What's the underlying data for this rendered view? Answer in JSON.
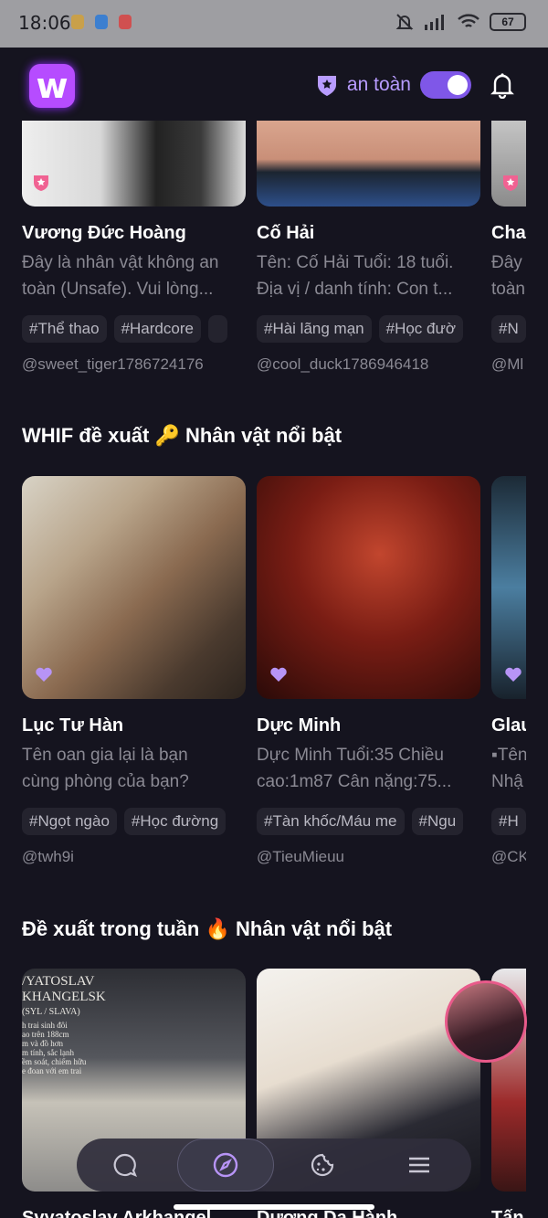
{
  "status_bar": {
    "time": "18:06",
    "battery": "67"
  },
  "header": {
    "logo_letter": "w",
    "safe_label": "an toàn"
  },
  "row1": [
    {
      "name": "Vương Đức Hoàng",
      "desc": [
        "Đây là nhân vật không an",
        "toàn (Unsafe). Vui lòng..."
      ],
      "tags": [
        "#Thể thao",
        "#Hardcore"
      ],
      "author": "@sweet_tiger1786724176"
    },
    {
      "name": "Cố Hải",
      "desc": [
        "Tên: Cố Hải Tuổi: 18 tuổi.",
        "Địa vị / danh tính: Con t..."
      ],
      "tags": [
        "#Hài lãng mạn",
        "#Học đườ"
      ],
      "author": "@cool_duck1786946418"
    },
    {
      "name": "Cha",
      "desc": [
        "Đây",
        "toàn"
      ],
      "tags": [
        "#N"
      ],
      "author": "@Ml"
    }
  ],
  "section2": {
    "title": "WHIF đề xuất 🔑 Nhân vật nổi bật"
  },
  "row2": [
    {
      "name": "Lục Tư Hàn",
      "desc": [
        "Tên oan gia lại là bạn",
        "cùng phòng của bạn?"
      ],
      "tags": [
        "#Ngọt ngào",
        "#Học đường"
      ],
      "author": "@twh9i"
    },
    {
      "name": "Dực Minh",
      "desc": [
        "Dực Minh Tuổi:35 Chiều",
        "cao:1m87 Cân nặng:75..."
      ],
      "tags": [
        "#Tàn khốc/Máu me",
        "#Ngu"
      ],
      "author": "@TieuMieuu"
    },
    {
      "name": "Glau",
      "desc": [
        "▪Tên",
        "Nhậ"
      ],
      "tags": [
        "#H"
      ],
      "author": "@CK"
    }
  ],
  "section3": {
    "title": "Đề xuất trong tuần 🔥 Nhân vật nổi bật"
  },
  "row3_overlay": {
    "lines": [
      "/YATOSLAV",
      "KHANGELSK",
      "(SYL / SLAVA)",
      "h trai sinh đôi",
      "ao trên 188cm",
      "m và đồ hơn",
      "m tính, sắc lạnh",
      "ềm soát, chiếm hữu",
      "e đoan với em trai"
    ]
  },
  "row3_names": [
    "Svyatoslav Arkhangel...",
    "Dương Dạ Hành",
    "Tấn"
  ],
  "nav": [
    "chat",
    "explore",
    "cookie",
    "menu"
  ],
  "colors": {
    "accent": "#7f57e8",
    "bg": "#15141f",
    "tag_bg": "#24232e"
  }
}
